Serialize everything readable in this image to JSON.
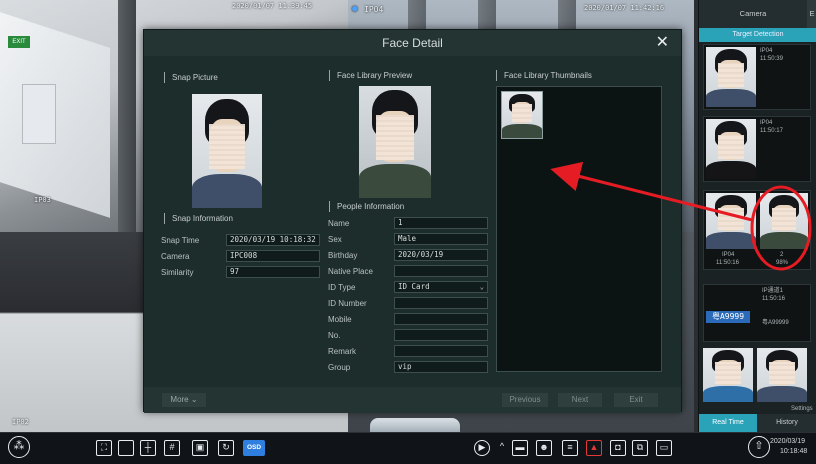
{
  "camera_osd": {
    "cam1_time": "2020/01/07 11:39:45",
    "cam2_label": "IP04",
    "cam2_time": "2020/01/07 11:42:16",
    "cam1_name": "IP03",
    "cam3_name": "IP02",
    "exit_text": "EXIT"
  },
  "dialog": {
    "title": "Face Detail",
    "snap_picture_title": "Snap Picture",
    "library_preview_title": "Face Library Preview",
    "library_thumbs_title": "Face Library Thumbnails",
    "snap_info_title": "Snap Information",
    "people_info_title": "People Information",
    "snap_info": [
      {
        "label": "Snap Time",
        "value": "2020/03/19 10:18:32"
      },
      {
        "label": "Camera",
        "value": "IPC008"
      },
      {
        "label": "Similarity",
        "value": "97"
      }
    ],
    "people_info": [
      {
        "label": "Name",
        "value": "1"
      },
      {
        "label": "Sex",
        "value": "Male"
      },
      {
        "label": "Birthday",
        "value": "2020/03/19"
      },
      {
        "label": "Native Place",
        "value": ""
      },
      {
        "label": "ID Type",
        "value": "ID Card"
      },
      {
        "label": "ID Number",
        "value": ""
      },
      {
        "label": "Mobile",
        "value": ""
      },
      {
        "label": "No.",
        "value": ""
      },
      {
        "label": "Remark",
        "value": ""
      },
      {
        "label": "Group",
        "value": "vip"
      }
    ],
    "more_label": "More",
    "previous_label": "Previous",
    "next_label": "Next",
    "exit_label": "Exit"
  },
  "side_panel": {
    "tab_camera": "Camera",
    "target_detection": "Target Detection",
    "cards": [
      {
        "cam": "IP04",
        "time": "11:50:39"
      },
      {
        "cam": "IP04",
        "time": "11:50:17"
      },
      {
        "cam": "IP04",
        "time": "11:50:16",
        "sub": "2",
        "sub2": "98%"
      },
      {
        "cam": "IP通道1",
        "time": "11:50:16",
        "plate": "粤A9999",
        "plate_small": "粤A99999"
      }
    ],
    "settings_label": "Settings",
    "real_time": "Real Time",
    "history": "History"
  },
  "toolbar": {
    "osd": "OSD",
    "date": "2020/03/19",
    "time": "10:18:48"
  },
  "colors": {
    "accent": "#2aa3b9",
    "annotation": "#e51c23",
    "osd_button": "#2f7fe0"
  }
}
